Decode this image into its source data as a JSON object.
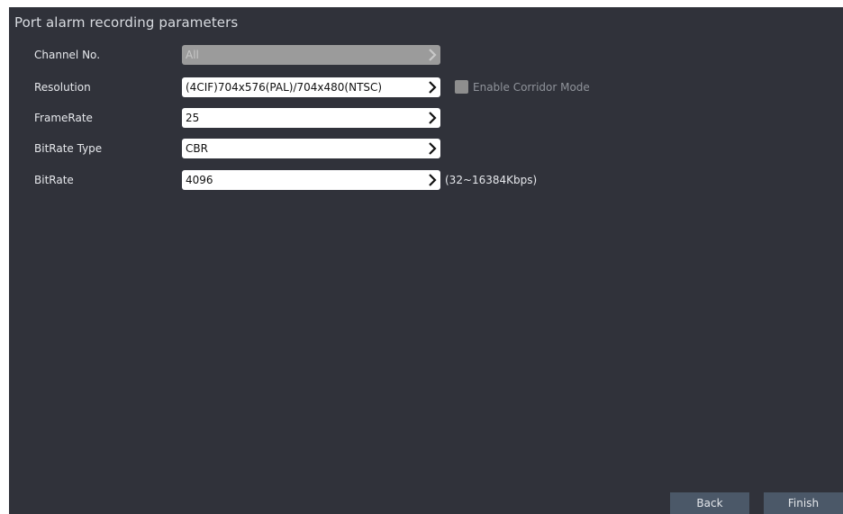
{
  "window": {
    "title": "Port alarm recording parameters"
  },
  "fields": [
    {
      "label": "Channel No.",
      "value": "All",
      "disabled": true
    },
    {
      "label": "Resolution",
      "value": "(4CIF)704x576(PAL)/704x480(NTSC)",
      "disabled": false
    },
    {
      "label": "FrameRate",
      "value": "25",
      "disabled": false
    },
    {
      "label": "BitRate Type",
      "value": "CBR",
      "disabled": false
    },
    {
      "label": "BitRate",
      "value": "4096",
      "disabled": false
    }
  ],
  "corridor": {
    "label": "Enable Corridor Mode",
    "checked": false
  },
  "bitrate_hint": "(32~16384Kbps)",
  "buttons": {
    "back": "Back",
    "finish": "Finish"
  },
  "icons": {
    "field_arrow": "chevron-right-icon",
    "checkbox": "checkbox-icon"
  },
  "colors": {
    "background": "#30323a",
    "button": "#4b5868",
    "disabled_field": "#9b9b9b"
  }
}
